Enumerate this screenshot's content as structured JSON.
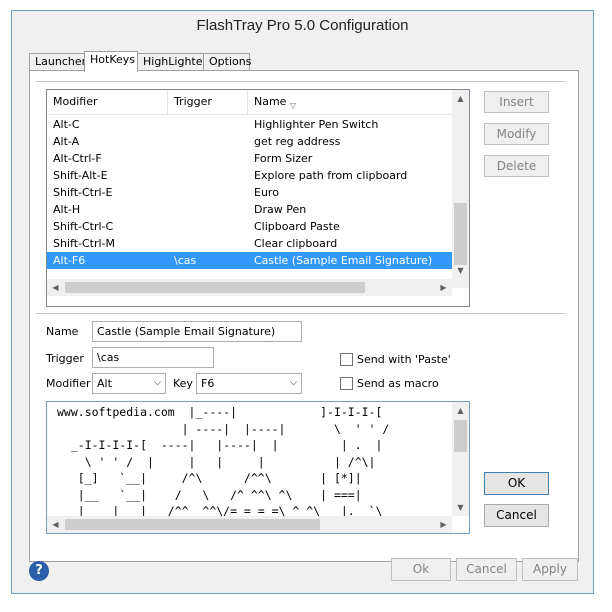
{
  "window": {
    "title": "FlashTray Pro 5.0 Configuration"
  },
  "tabs": [
    "Launcher",
    "HotKeys",
    "HighLighter",
    "Options"
  ],
  "hotkeys_list": {
    "columns": [
      "Modifier",
      "Trigger",
      "Name"
    ],
    "rows": [
      {
        "modifier": "Alt-C",
        "trigger": "",
        "name": "Highlighter Pen Switch"
      },
      {
        "modifier": "Alt-A",
        "trigger": "",
        "name": "get reg address"
      },
      {
        "modifier": "Alt-Ctrl-F",
        "trigger": "",
        "name": "Form Sizer"
      },
      {
        "modifier": "Shift-Alt-E",
        "trigger": "",
        "name": "Explore path from clipboard"
      },
      {
        "modifier": "Shift-Ctrl-E",
        "trigger": "",
        "name": "Euro"
      },
      {
        "modifier": "Alt-H",
        "trigger": "",
        "name": "Draw Pen"
      },
      {
        "modifier": "Shift-Ctrl-C",
        "trigger": "",
        "name": "Clipboard Paste"
      },
      {
        "modifier": "Shift-Ctrl-M",
        "trigger": "",
        "name": "Clear clipboard"
      },
      {
        "modifier": "Alt-F6",
        "trigger": "\\cas",
        "name": "Castle (Sample Email Signature)"
      }
    ],
    "selected_index": 8
  },
  "side_buttons": {
    "insert": "Insert",
    "modify": "Modify",
    "delete": "Delete"
  },
  "form": {
    "name_label": "Name",
    "name_value": "Castle (Sample Email Signature)",
    "trigger_label": "Trigger",
    "trigger_value": "\\cas",
    "modifier_label": "Modifier",
    "modifier_value": "Alt",
    "key_label": "Key",
    "key_value": "F6",
    "send_paste_label": "Send with 'Paste'",
    "send_macro_label": "Send as macro"
  },
  "ascii_text": "www.softpedia.com  |_----|            ]-I-I-I-[\n                  | ----|  |----|       \\  ' ' /\n  _-I-I-I-I-[  ----|   |----|  |         | .  |\n    \\ ' ' /  |     |   |     |          | /^\\|\n   [_]   `__|     /^\\      /^^\\       | [*]|\n   |__   `__|    /   \\   /^ ^^\\ ^\\    | ===|\n___|___ |___|   /^^  ^^\\/=_=_=_=\\ ^ ^\\   |.  `\\",
  "dialog_buttons": {
    "ok": "OK",
    "cancel": "Cancel"
  },
  "footer_buttons": {
    "ok": "Ok",
    "cancel": "Cancel",
    "apply": "Apply"
  },
  "help_icon": "?"
}
